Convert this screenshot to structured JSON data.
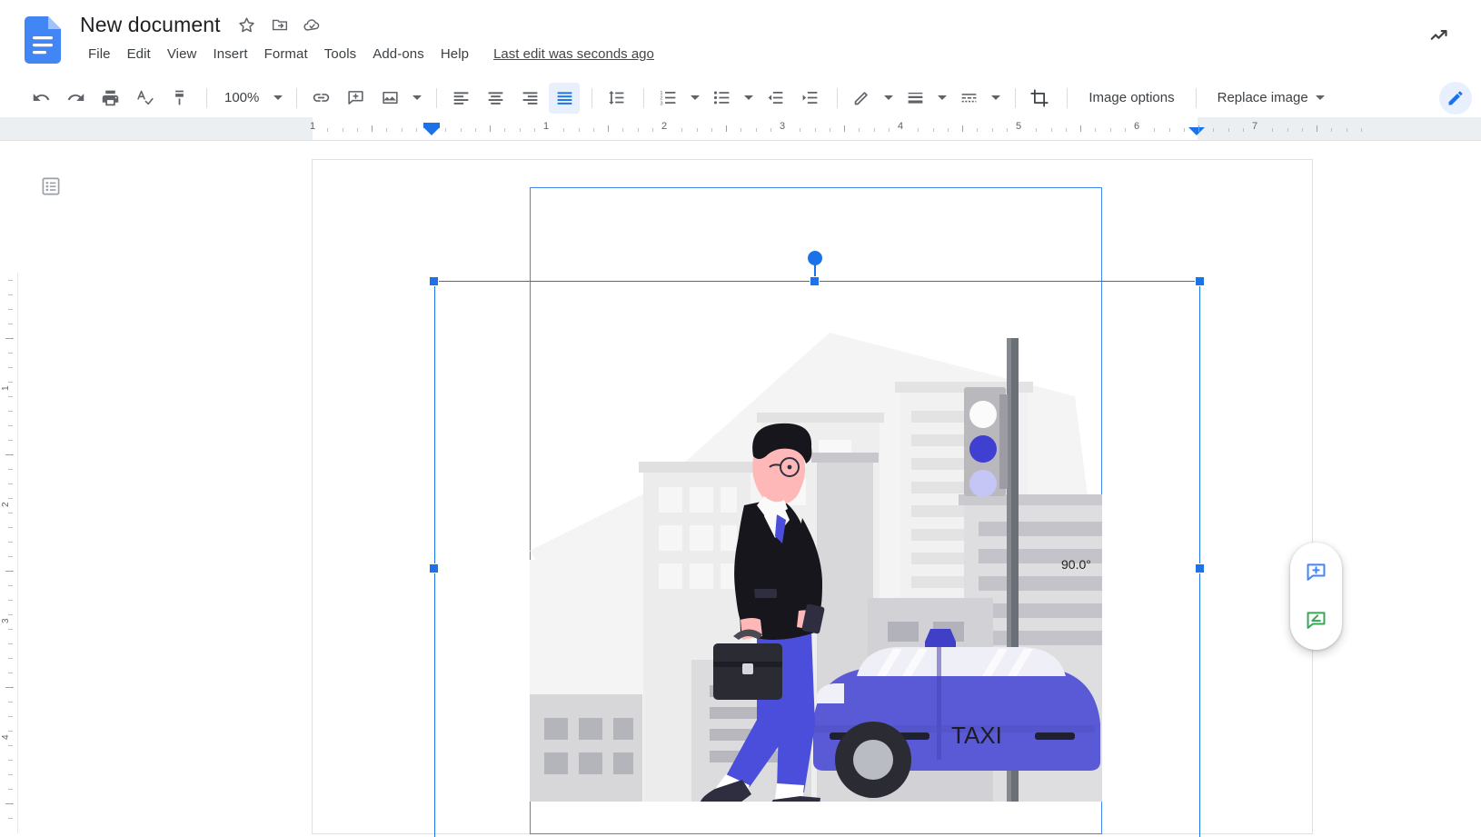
{
  "header": {
    "doc_title": "New document",
    "logo_icon": "google-docs-logo",
    "star_icon": "star-outline-icon",
    "move_icon": "move-to-folder-icon",
    "cloud_icon": "cloud-saved-icon",
    "trend_icon": "trending-up-icon",
    "last_edit": "Last edit was seconds ago",
    "menus": [
      {
        "label": "File",
        "name": "menu-file"
      },
      {
        "label": "Edit",
        "name": "menu-edit"
      },
      {
        "label": "View",
        "name": "menu-view"
      },
      {
        "label": "Insert",
        "name": "menu-insert"
      },
      {
        "label": "Format",
        "name": "menu-format"
      },
      {
        "label": "Tools",
        "name": "menu-tools"
      },
      {
        "label": "Add-ons",
        "name": "menu-addons"
      },
      {
        "label": "Help",
        "name": "menu-help"
      }
    ]
  },
  "toolbar": {
    "undo_icon": "undo-icon",
    "redo_icon": "redo-icon",
    "print_icon": "print-icon",
    "spelling_icon": "spelling-check-icon",
    "paint_format_icon": "paint-format-icon",
    "zoom_value": "100%",
    "zoom_caret_icon": "chevron-down-icon",
    "link_icon": "insert-link-icon",
    "comment_icon": "add-comment-icon",
    "image_icon": "insert-image-icon",
    "image_caret_icon": "chevron-down-icon",
    "align_left_icon": "align-left-icon",
    "align_center_icon": "align-center-icon",
    "align_right_icon": "align-right-icon",
    "align_justify_icon": "align-justify-icon",
    "line_spacing_icon": "line-spacing-icon",
    "numbered_list_icon": "numbered-list-icon",
    "numbered_list_caret_icon": "chevron-down-icon",
    "bulleted_list_icon": "bulleted-list-icon",
    "bulleted_list_caret_icon": "chevron-down-icon",
    "decrease_indent_icon": "decrease-indent-icon",
    "increase_indent_icon": "increase-indent-icon",
    "border_color_icon": "border-color-pencil-icon",
    "border_color_caret_icon": "chevron-down-icon",
    "border_weight_icon": "border-weight-icon",
    "border_weight_caret_icon": "chevron-down-icon",
    "border_dash_icon": "border-dash-icon",
    "border_dash_caret_icon": "chevron-down-icon",
    "crop_icon": "crop-icon",
    "image_options_label": "Image options",
    "replace_image_label": "Replace image",
    "replace_image_caret_icon": "chevron-down-icon",
    "edit_mode_icon": "edit-pencil-mode-icon",
    "active_button": "align-justify-icon"
  },
  "ruler": {
    "horizontal_ticks": [
      "1",
      "1",
      "2",
      "3",
      "4",
      "5",
      "6",
      "7"
    ],
    "vertical_ticks": [
      "1",
      "2",
      "3",
      "4"
    ],
    "left_indent_marker": "left-indent-marker",
    "right_indent_marker": "right-indent-marker"
  },
  "document": {
    "outline_icon": "document-outline-icon"
  },
  "selection": {
    "angle_label": "90.0°",
    "rotation_handle": "rotation-handle",
    "handles": [
      "top-left",
      "top-center",
      "top-right",
      "middle-left",
      "middle-right"
    ],
    "accent_color": "#1a73e8"
  },
  "image_content": {
    "alt": "Illustration of a businessman walking with a briefcase and phone past a city skyline, a traffic light and a blue taxi",
    "taxi_label": "TAXI",
    "colors": {
      "suit": "#2f2e41",
      "pants": "#4b4ddb",
      "taxi_body": "#5a5ad6",
      "taxi_body_dark": "#4a46b8",
      "skin": "#ffb8b8",
      "background": "#f2f2f2",
      "building_light": "#e6e6e6",
      "building_mid": "#d4d4d6",
      "building_dark": "#b0b0b6",
      "pole": "#5f6369",
      "light_green": "#3f3fd1",
      "light_off": "#c5c6f5"
    }
  },
  "fab": {
    "add_comment_icon": "add-comment-icon",
    "suggest_edit_icon": "suggest-edit-icon",
    "add_comment_color": "#4285f4",
    "suggest_edit_color": "#34a853"
  }
}
